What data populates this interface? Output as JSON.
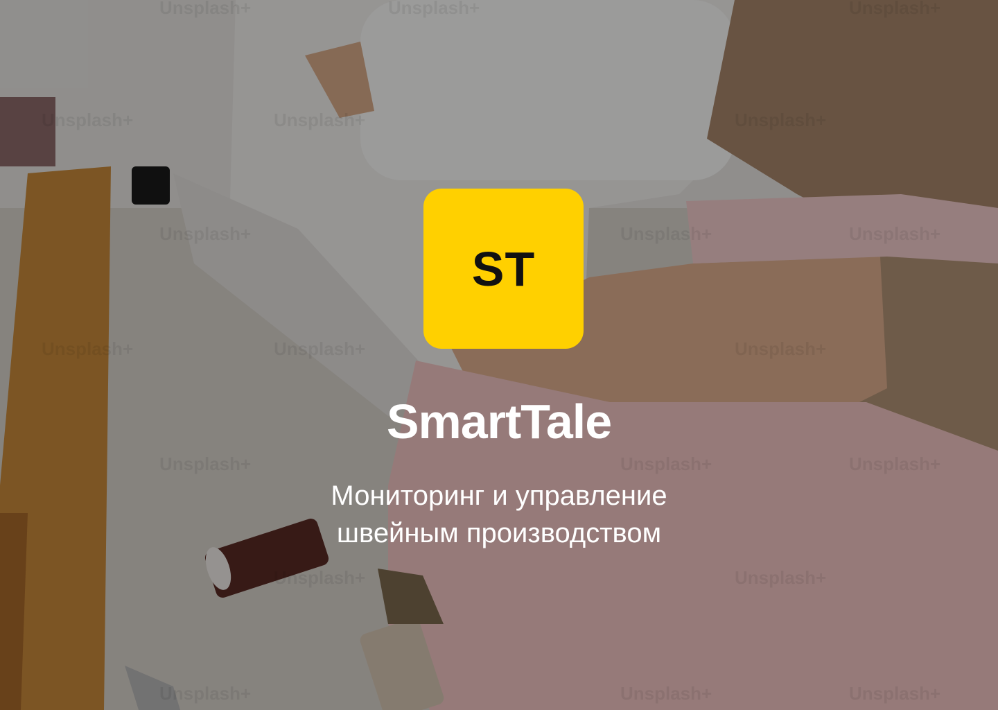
{
  "background": {
    "watermark_text": "Unsplash+",
    "overlay_color": "#000000"
  },
  "logo": {
    "text": "ST",
    "tile_color": "#FFD000",
    "text_color": "#111111"
  },
  "app_name": "SmartTale",
  "tagline": {
    "line1": "Мониторинг и управление",
    "line2": "швейным производством"
  }
}
